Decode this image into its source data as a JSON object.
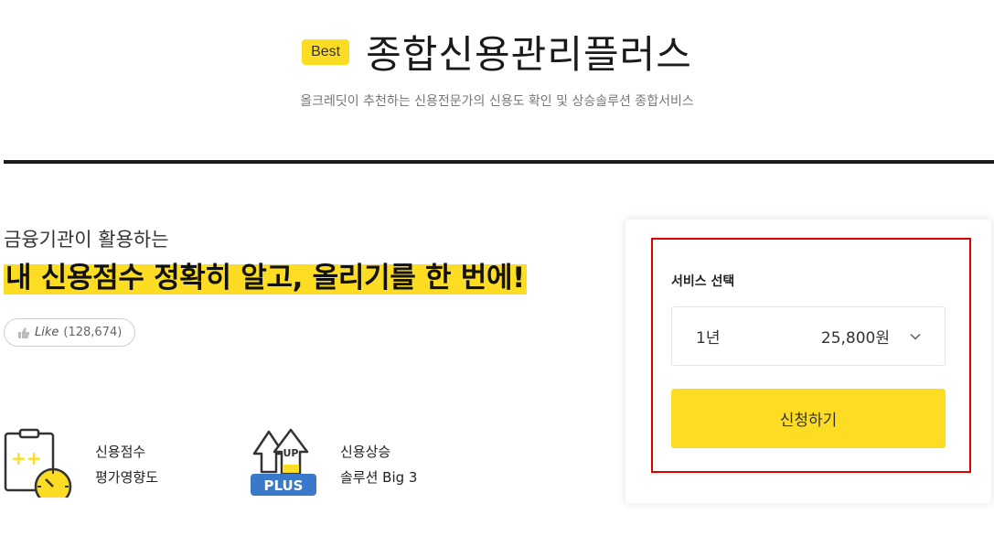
{
  "header": {
    "badge": "Best",
    "title": "종합신용관리플러스",
    "subtitle": "올크레딧이 추천하는 신용전문가의 신용도 확인 및 상승솔루션 종합서비스"
  },
  "intro": {
    "lead": "금융기관이 활용하는",
    "headline": "내 신용점수 정확히 알고, 올리기를 한 번에!",
    "like_label": "Like",
    "like_count": "(128,674)"
  },
  "features": [
    {
      "icon": "clipboard-gauge-icon",
      "line1": "신용점수",
      "line2": "평가영향도"
    },
    {
      "icon": "up-plus-icon",
      "line1": "신용상승",
      "line2": "솔루션 Big 3",
      "icon_text_up": "UP",
      "icon_text_plus": "PLUS"
    }
  ],
  "order": {
    "service_label": "서비스 선택",
    "selected_period": "1년",
    "selected_price": "25,800원",
    "apply_label": "신청하기"
  },
  "colors": {
    "accent_yellow": "#fddd24",
    "highlight_red": "#e00000",
    "plus_blue": "#3a78c9"
  }
}
